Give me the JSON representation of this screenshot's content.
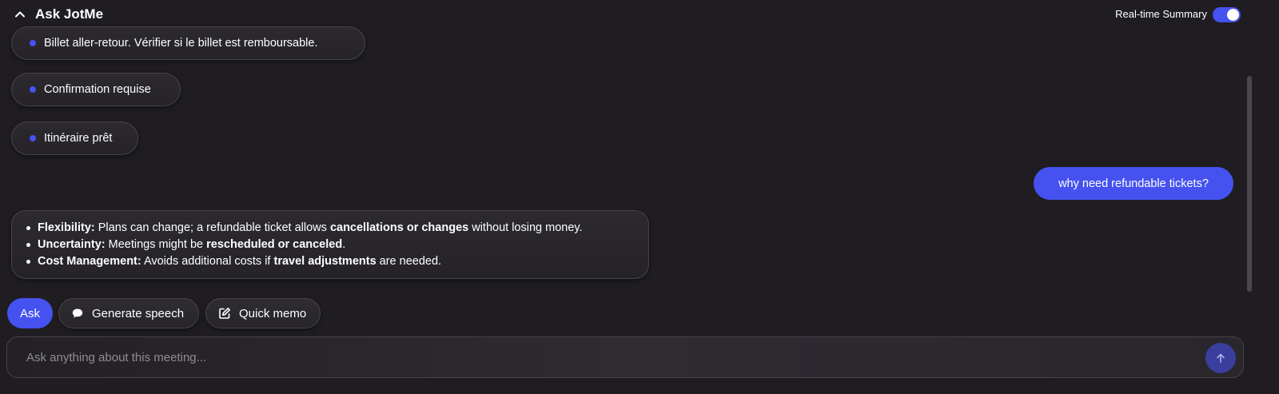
{
  "header": {
    "title": "Ask JotMe",
    "collapse_icon": "chevron-up-icon",
    "realtime_label": "Real-time Summary",
    "realtime_enabled": true
  },
  "colors": {
    "accent": "#4552f0",
    "background": "#1f1d21",
    "send_button": "#3a3f9e"
  },
  "chat": {
    "pills": [
      {
        "text": "Billet aller-retour. Vérifier si le billet est remboursable."
      },
      {
        "text": "Confirmation requise"
      },
      {
        "text": "Itinéraire prêt"
      }
    ],
    "user_message": "why need refundable tickets?",
    "answer": [
      {
        "label": "Flexibility:",
        "text_before": " Plans can change; a refundable ticket allows ",
        "bold": "cancellations or changes",
        "text_after": " without losing money."
      },
      {
        "label": "Uncertainty:",
        "text_before": " Meetings might be ",
        "bold": "rescheduled or canceled",
        "text_after": "."
      },
      {
        "label": "Cost Management:",
        "text_before": " Avoids additional costs if ",
        "bold": "travel adjustments",
        "text_after": " are needed."
      }
    ]
  },
  "actions": {
    "ask_label": "Ask",
    "speech_label": "Generate speech",
    "speech_icon": "chat-bubble-icon",
    "memo_label": "Quick memo",
    "memo_icon": "edit-icon"
  },
  "input": {
    "placeholder": "Ask anything about this meeting...",
    "value": "",
    "send_icon": "arrow-up-icon"
  }
}
